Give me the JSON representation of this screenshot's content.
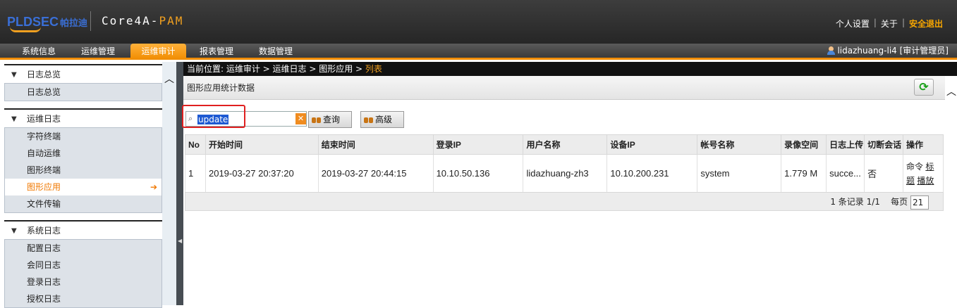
{
  "header": {
    "logo_brand": "PLDSEC",
    "logo_cn": "帕拉迪",
    "product_prefix": "Core4A-",
    "product_suffix": "PAM",
    "links": [
      "个人设置",
      "关于",
      "安全退出"
    ]
  },
  "nav": {
    "tabs": [
      "系统信息",
      "运维管理",
      "运维审计",
      "报表管理",
      "数据管理"
    ],
    "active_tab": "运维审计",
    "user": "lidazhuang-li4 [审计管理员]"
  },
  "sidebar": {
    "groups": [
      {
        "title": "日志总览",
        "items": [
          "日志总览"
        ]
      },
      {
        "title": "运维日志",
        "items": [
          "字符终端",
          "自动运维",
          "图形终端",
          "图形应用",
          "文件传输"
        ]
      },
      {
        "title": "系统日志",
        "items": [
          "配置日志",
          "会同日志",
          "登录日志",
          "授权日志"
        ]
      }
    ],
    "active_item": "图形应用"
  },
  "breadcrumb": {
    "prefix": "当前位置: 运维审计 > 运维日志 > 图形应用 > ",
    "current": "列表"
  },
  "panel": {
    "title": "图形应用统计数据"
  },
  "search": {
    "value": "update",
    "query_label": "查询",
    "advanced_label": "高级"
  },
  "table": {
    "columns": [
      "No",
      "开始时间",
      "结束时间",
      "登录IP",
      "用户名称",
      "设备IP",
      "帐号名称",
      "录像空间",
      "日志上传",
      "切断会话",
      "操作"
    ],
    "rows": [
      {
        "no": "1",
        "start": "2019-03-27 20:37:20",
        "end": "2019-03-27 20:44:15",
        "login_ip": "10.10.50.136",
        "user": "lidazhuang-zh3",
        "device_ip": "10.10.200.231",
        "account": "system",
        "video_size": "1.779 M",
        "upload": "succe...",
        "cut_session": "否",
        "op_cmd": "命令",
        "op_title_1": "标",
        "op_title_2": "题",
        "op_play": "播放"
      }
    ]
  },
  "pager": {
    "records": "1 条记录 1/1",
    "per_page_label": "每页",
    "per_page": "21"
  },
  "colors": {
    "accent": "#f08c00",
    "logout": "#f7a600",
    "highlight_box": "#e02020"
  }
}
